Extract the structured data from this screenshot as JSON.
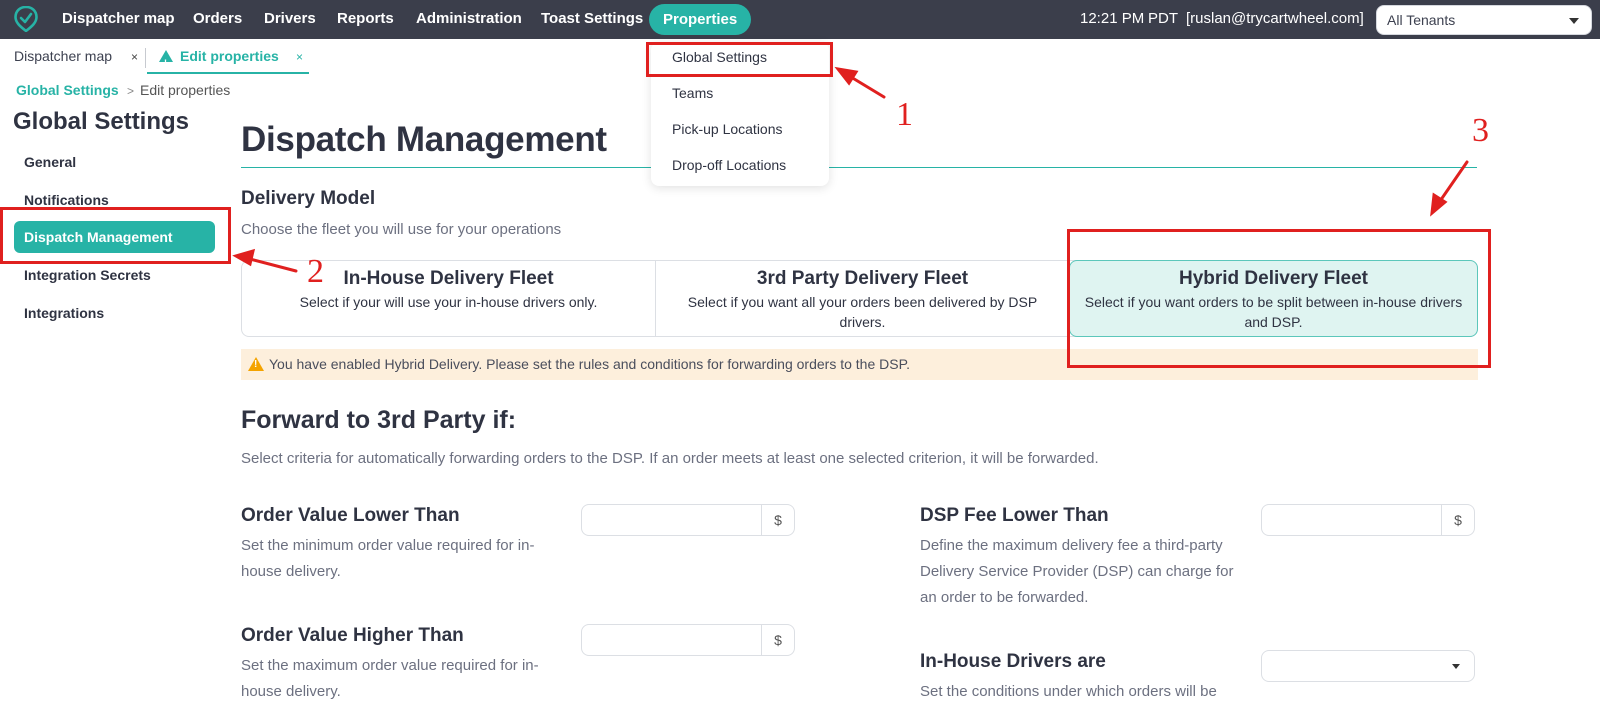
{
  "nav": {
    "items": [
      "Dispatcher map",
      "Orders",
      "Drivers",
      "Reports",
      "Administration",
      "Toast Settings",
      "Properties"
    ],
    "time": "12:21 PM",
    "timezone": "PDT",
    "user": "[ruslan@trycartwheel.com]",
    "tenant": "All Tenants"
  },
  "tabs": {
    "first": "Dispatcher map",
    "active": "Edit properties",
    "close": "×"
  },
  "breadcrumb": {
    "root": "Global Settings",
    "sep": ">",
    "current": "Edit properties"
  },
  "sidebar": {
    "title": "Global Settings",
    "items": [
      "General",
      "Notifications",
      "Dispatch Management",
      "Integration Secrets",
      "Integrations"
    ]
  },
  "main": {
    "title": "Dispatch Management",
    "delivery_model": {
      "heading": "Delivery Model",
      "subtitle": "Choose the fleet you will use for your operations",
      "cards": [
        {
          "title": "In-House Delivery Fleet",
          "desc": "Select if your will use your in-house drivers only."
        },
        {
          "title": "3rd Party Delivery Fleet",
          "desc": "Select if you want all your orders been delivered by DSP drivers."
        },
        {
          "title": "Hybrid Delivery Fleet",
          "desc": "Select if you want orders to be split between in-house drivers and DSP."
        }
      ],
      "selected": "Hybrid Delivery Fleet"
    },
    "warning": "You have enabled Hybrid Delivery. Please set the rules and conditions for forwarding orders to the DSP.",
    "forward": {
      "heading": "Forward to 3rd Party if:",
      "subtitle": "Select criteria for automatically forwarding orders to the DSP. If an order meets at least one selected criterion, it will be forwarded.",
      "criteria": [
        {
          "title": "Order Value Lower Than",
          "desc": "Set the minimum order value required for in-house delivery.",
          "value": "",
          "unit": "$"
        },
        {
          "title": "DSP Fee Lower Than",
          "desc": "Define the maximum delivery fee a third-party Delivery Service Provider (DSP) can charge for an order to be forwarded.",
          "value": "",
          "unit": "$"
        },
        {
          "title": "Order Value Higher Than",
          "desc": "Set the maximum order value required for in-house delivery.",
          "value": "",
          "unit": "$"
        },
        {
          "title": "In-House Drivers are",
          "desc": "Set the conditions under which orders will be",
          "value": ""
        }
      ]
    }
  },
  "properties_menu": {
    "items": [
      "Global Settings",
      "Teams",
      "Pick-up Locations",
      "Drop-off Locations"
    ]
  },
  "annotations": {
    "numbers": [
      "1",
      "2",
      "3"
    ],
    "color": "#e0201f"
  },
  "colors": {
    "nav_bg": "#3b3e4b",
    "accent": "#27b3a6",
    "warning_bg": "#fdefdc",
    "warning_icon": "#f4a300",
    "selected_card_bg": "#dff4f1"
  }
}
